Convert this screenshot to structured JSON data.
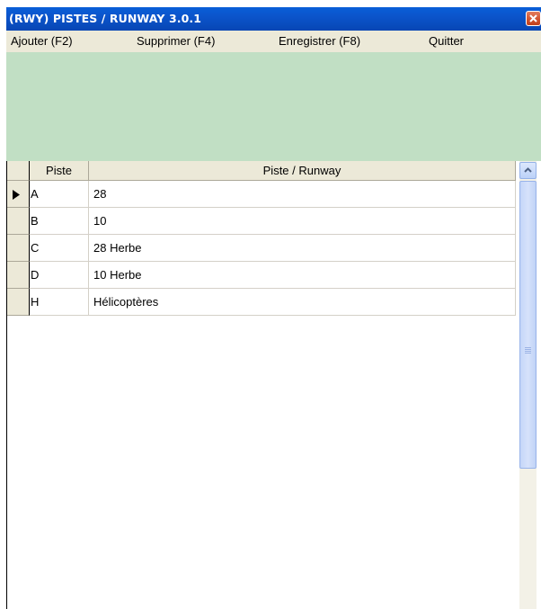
{
  "window": {
    "title": "(RWY) PISTES / RUNWAY 3.0.1",
    "close_icon": "close-icon"
  },
  "menu": {
    "items": [
      {
        "label": "Ajouter (F2)"
      },
      {
        "label": "Supprimer (F4)"
      },
      {
        "label": "Enregistrer (F8)"
      },
      {
        "label": "Quitter"
      }
    ]
  },
  "colors": {
    "title_bar": "#0a5fd8",
    "panel_green": "#c1dfc4",
    "face": "#ece9d8"
  },
  "grid": {
    "columns": [
      "Piste",
      "Piste / Runway"
    ],
    "current_row_icon": "row-pointer-icon",
    "rows": [
      {
        "code": "A",
        "name": "28"
      },
      {
        "code": "B",
        "name": "10"
      },
      {
        "code": "C",
        "name": "28 Herbe"
      },
      {
        "code": "D",
        "name": "10 Herbe"
      },
      {
        "code": "H",
        "name": "Hélicoptères"
      }
    ],
    "current_row": 0
  }
}
